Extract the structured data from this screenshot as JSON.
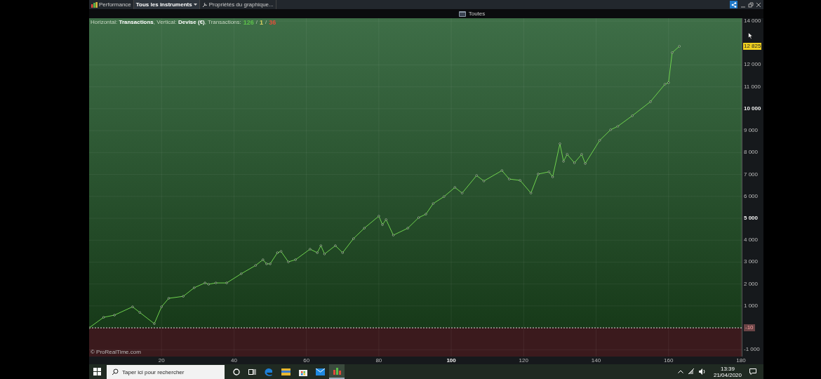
{
  "toolbar": {
    "tabs": [
      {
        "label": "Performance",
        "kind": "app",
        "selected": false
      },
      {
        "label": "Tous les instruments",
        "kind": "dropdown",
        "selected": true
      },
      {
        "label": "Propriétés du graphique...",
        "kind": "properties",
        "selected": false
      }
    ]
  },
  "filter": {
    "label": "Toutes"
  },
  "chart": {
    "info": "Horizontal: **Transactions**, Vertical: **Devise (€)**, Transactions:",
    "counts": [
      {
        "text": "126",
        "color": "#5cc04a"
      },
      {
        "text": "1",
        "color": "#d8d060"
      },
      {
        "text": "36",
        "color": "#e0503a"
      }
    ],
    "separator": "/",
    "last_value": "12 825",
    "zero_tag": "-10",
    "copyright": "© ProRealTime.com",
    "chart_data": {
      "type": "line",
      "grid": true,
      "ref_lines": [
        {
          "axis": "y",
          "value": 0
        }
      ],
      "xlim": [
        0,
        180.2
      ],
      "ylim": [
        -1310,
        14130
      ],
      "xticks": [
        20,
        40,
        60,
        80,
        100,
        120,
        140,
        160,
        180
      ],
      "yticks": [
        {
          "value": -1000,
          "label": "-1 000"
        },
        {
          "value": 1000,
          "label": "1 000"
        },
        {
          "value": 2000,
          "label": "2 000"
        },
        {
          "value": 3000,
          "label": "3 000"
        },
        {
          "value": 4000,
          "label": "4 000"
        },
        {
          "value": 5000,
          "label": "5 000"
        },
        {
          "value": 6000,
          "label": "6 000"
        },
        {
          "value": 7000,
          "label": "7 000"
        },
        {
          "value": 8000,
          "label": "8 000"
        },
        {
          "value": 9000,
          "label": "9 000"
        },
        {
          "value": 10000,
          "label": "10 000"
        },
        {
          "value": 11000,
          "label": "11 000"
        },
        {
          "value": 12000,
          "label": "12 000"
        },
        {
          "value": 14000,
          "label": "14 000"
        }
      ],
      "x": [
        0,
        4,
        7,
        12,
        14,
        18,
        20,
        22,
        26,
        29,
        32,
        33,
        35,
        38,
        42,
        46,
        48,
        49,
        50,
        52,
        53,
        55,
        57,
        61,
        63,
        64,
        65,
        68,
        70,
        73,
        76,
        80,
        81,
        82,
        84,
        88,
        91,
        93,
        95,
        98,
        101,
        103,
        107,
        109,
        114,
        116,
        119,
        122,
        124,
        127,
        128,
        130,
        131,
        132,
        134,
        136,
        137,
        141,
        144,
        146,
        150,
        155,
        159,
        160,
        161,
        163
      ],
      "series": [
        {
          "color": "#6fd24e",
          "marker": "o",
          "values": [
            0,
            480,
            580,
            960,
            700,
            190,
            960,
            1350,
            1440,
            1830,
            2050,
            1990,
            2050,
            2050,
            2470,
            2850,
            3110,
            2920,
            2920,
            3430,
            3490,
            3010,
            3110,
            3590,
            3430,
            3750,
            3370,
            3750,
            3430,
            4070,
            4550,
            5100,
            4710,
            4940,
            4230,
            4550,
            5030,
            5190,
            5670,
            5990,
            6410,
            6150,
            6950,
            6700,
            7180,
            6790,
            6730,
            6150,
            7020,
            7120,
            6890,
            8400,
            7600,
            7920,
            7530,
            7920,
            7500,
            8560,
            9040,
            9200,
            9680,
            10320,
            11120,
            11190,
            12560,
            12850
          ]
        }
      ]
    }
  },
  "taskbar": {
    "search": {
      "placeholder": "Taper ici pour rechercher"
    },
    "time": "13:39",
    "date": "21/04/2020"
  }
}
